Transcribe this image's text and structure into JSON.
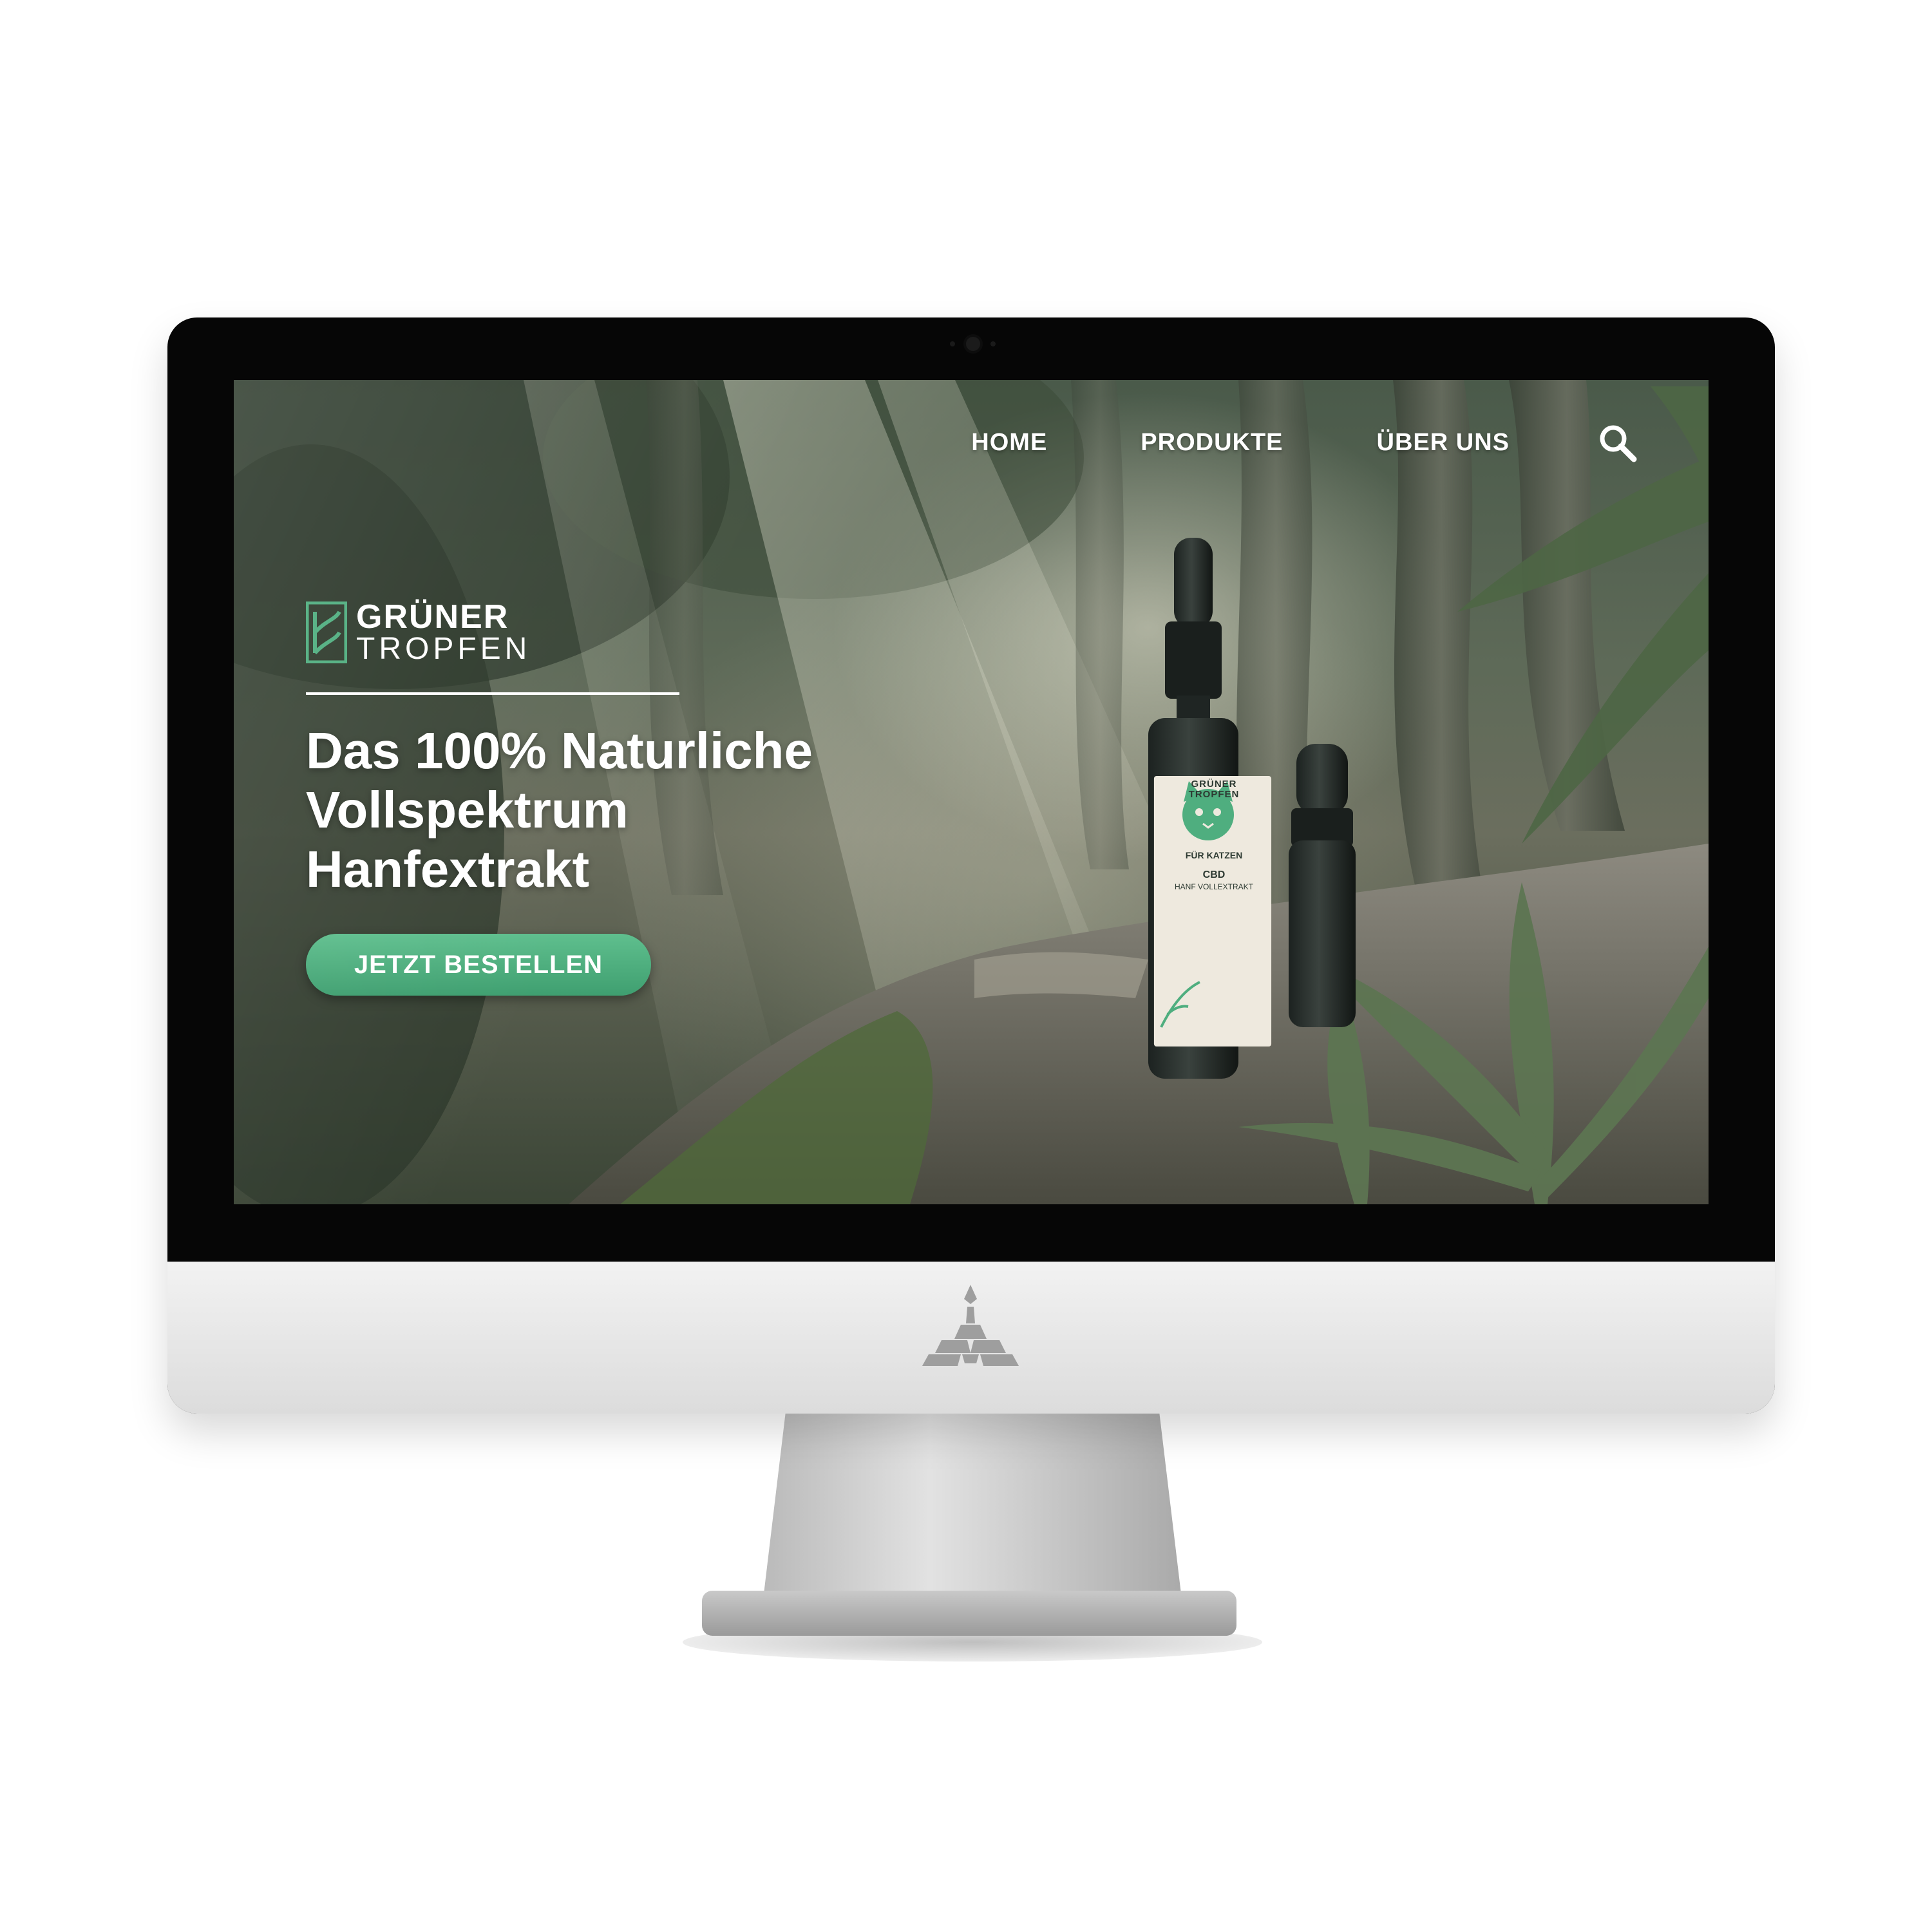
{
  "nav": {
    "items": [
      {
        "label": "HOME"
      },
      {
        "label": "PRODUKTE"
      },
      {
        "label": "ÜBER UNS"
      }
    ],
    "search_icon": "search-icon"
  },
  "brand": {
    "line1": "GRÜNER",
    "line2": "TROPFEN"
  },
  "hero": {
    "headline": [
      "Das 100% Naturliche",
      "Vollspektrum",
      "Hanfextrakt"
    ],
    "cta_label": "JETZT BESTELLEN"
  },
  "product": {
    "label_brand_1": "GRÜNER",
    "label_brand_2": "TROPFEN",
    "label_for": "FÜR KATZEN",
    "label_cbd": "CBD",
    "label_sub": "HANF VOLLEXTRAKT"
  },
  "colors": {
    "accent": "#4fae7f",
    "text": "#ffffff",
    "bezel": "#060606"
  }
}
